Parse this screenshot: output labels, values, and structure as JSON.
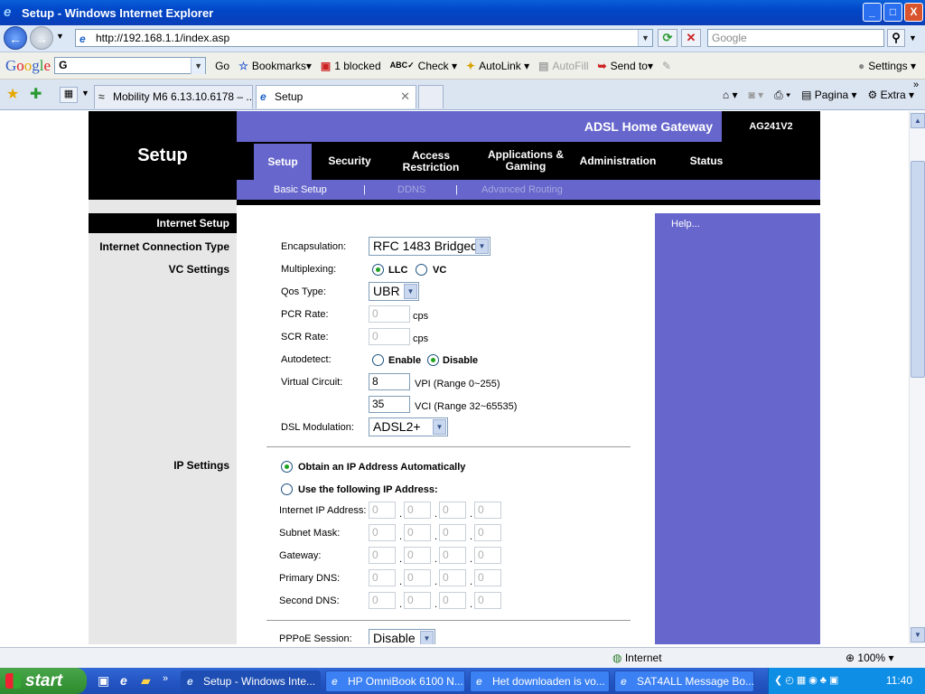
{
  "window": {
    "title": "Setup - Windows Internet Explorer",
    "min": "_",
    "max": "□",
    "close": "X"
  },
  "address": {
    "url": "http://192.168.1.1/index.asp",
    "search_placeholder": "Google"
  },
  "google_toolbar": {
    "logo": [
      "G",
      "o",
      "o",
      "g",
      "l",
      "e"
    ],
    "search_value": "G",
    "go": "Go",
    "bookmarks": "Bookmarks",
    "blocked": "1 blocked",
    "check": "Check",
    "autolink": "AutoLink",
    "autofill": "AutoFill",
    "send_to": "Send to",
    "settings": "Settings"
  },
  "tabs": [
    {
      "label": "Mobility M6 6.13.10.6178 – ..."
    },
    {
      "label": "Setup"
    }
  ],
  "command_bar": {
    "pagina": "Pagina",
    "extra": "Extra"
  },
  "router": {
    "section_title": "Setup",
    "product": "ADSL Home Gateway",
    "model": "AG241V2",
    "nav": [
      {
        "label": "Setup"
      },
      {
        "label": "Security"
      },
      {
        "label": "Access Restriction"
      },
      {
        "label": "Applications & Gaming"
      },
      {
        "label": "Administration"
      },
      {
        "label": "Status"
      }
    ],
    "subnav": {
      "basic": "Basic Setup",
      "sep1": "|",
      "ddns": "DDNS",
      "sep2": "|",
      "advanced": "Advanced Routing"
    },
    "left": {
      "internet_setup": "Internet Setup",
      "connection_type": "Internet Connection Type",
      "vc_settings": "VC Settings",
      "ip_settings": "IP Settings"
    },
    "help": "Help...",
    "form": {
      "encapsulation_label": "Encapsulation:",
      "encapsulation_value": "RFC 1483 Bridged",
      "multiplexing_label": "Multiplexing:",
      "llc": "LLC",
      "vc": "VC",
      "qos_label": "Qos Type:",
      "qos_value": "UBR",
      "pcr_label": "PCR Rate:",
      "pcr_value": "0",
      "pcr_unit": "cps",
      "scr_label": "SCR Rate:",
      "scr_value": "0",
      "scr_unit": "cps",
      "autodetect_label": "Autodetect:",
      "enable": "Enable",
      "disable": "Disable",
      "vc_label": "Virtual Circuit:",
      "vpi_value": "8",
      "vpi_range": "VPI (Range 0~255)",
      "vci_value": "35",
      "vci_range": "VCI (Range 32~65535)",
      "dsl_label": "DSL Modulation:",
      "dsl_value": "ADSL2+",
      "obtain_ip": "Obtain an IP Address Automatically",
      "use_ip": "Use the following IP Address:",
      "ip_rows": [
        {
          "label": "Internet IP Address:",
          "octets": [
            "0",
            "0",
            "0",
            "0"
          ]
        },
        {
          "label": "Subnet Mask:",
          "octets": [
            "0",
            "0",
            "0",
            "0"
          ]
        },
        {
          "label": "Gateway:",
          "octets": [
            "0",
            "0",
            "0",
            "0"
          ]
        },
        {
          "label": "Primary DNS:",
          "octets": [
            "0",
            "0",
            "0",
            "0"
          ]
        },
        {
          "label": "Second DNS:",
          "octets": [
            "0",
            "0",
            "0",
            "0"
          ]
        }
      ],
      "pppoe_label": "PPPoE Session:",
      "pppoe_value": "Disable"
    }
  },
  "status": {
    "zone": "Internet",
    "zoom": "100%"
  },
  "taskbar": {
    "start": "start",
    "tasks": [
      {
        "label": "Setup - Windows Inte..."
      },
      {
        "label": "HP OmniBook 6100 N..."
      },
      {
        "label": "Het downloaden is vo..."
      },
      {
        "label": "SAT4ALL Message Bo..."
      }
    ],
    "clock": "11:40"
  }
}
